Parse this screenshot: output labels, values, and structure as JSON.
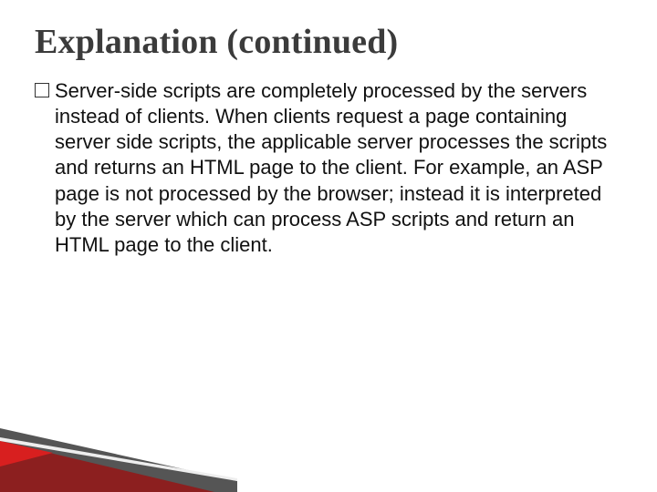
{
  "slide": {
    "title": "Explanation (continued)",
    "bullet_glyph": "",
    "body_text": "Server-side scripts are completely processed by the servers instead of clients. When clients request a page containing server side scripts, the applicable server processes the scripts and returns an HTML page to the client. For example, an ASP page is not processed by the browser; instead it is interpreted by the server which can process ASP scripts and return an HTML page to the client."
  }
}
